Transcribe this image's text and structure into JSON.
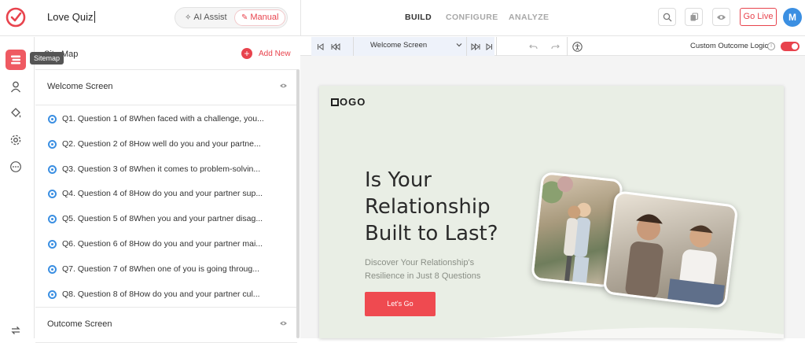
{
  "app": {
    "quiz_title": "Love Quiz",
    "modes": {
      "ai_assist": "AI Assist",
      "manual": "Manual",
      "active": "Manual"
    },
    "nav_tabs": [
      {
        "label": "BUILD",
        "active": true
      },
      {
        "label": "CONFIGURE",
        "active": false
      },
      {
        "label": "ANALYZE",
        "active": false
      }
    ],
    "actions": {
      "go_live": "Go Live",
      "avatar_initial": "M"
    },
    "accent_color": "#e8434d"
  },
  "left_rail": {
    "items": [
      "sitemap-icon",
      "user-icon",
      "paint-bucket-icon",
      "gear-icon",
      "more-icon",
      "sync-icon"
    ],
    "active": "sitemap-icon",
    "tooltip": "Sitemap"
  },
  "sitemap": {
    "title": "Site Map",
    "add_new": "Add New",
    "welcome_screen": "Welcome Screen",
    "questions": [
      "Q1. Question 1 of 8When faced with a challenge, you...",
      "Q2. Question 2 of 8How well do you and your partne...",
      "Q3. Question 3 of 8When it comes to problem-solvin...",
      "Q4. Question 4 of 8How do you and your partner sup...",
      "Q5. Question 5 of 8When you and your partner disag...",
      "Q6. Question 6 of 8How do you and your partner mai...",
      "Q7. Question 7 of 8When one of you is going throug...",
      "Q8. Question 8 of 8How do you and your partner cul..."
    ],
    "outcome_screen": "Outcome Screen"
  },
  "toolbar": {
    "selected_screen": "Welcome Screen",
    "custom_outcome_logic": "Custom Outcome Logic",
    "custom_outcome_enabled": true
  },
  "preview": {
    "logo": "OGO",
    "headline_lines": [
      "Is Your",
      "Relationship",
      "Built to Last?"
    ],
    "subtext_lines": [
      "Discover Your Relationship's",
      "Resilience in Just 8 Questions"
    ],
    "cta": "Let's Go"
  }
}
